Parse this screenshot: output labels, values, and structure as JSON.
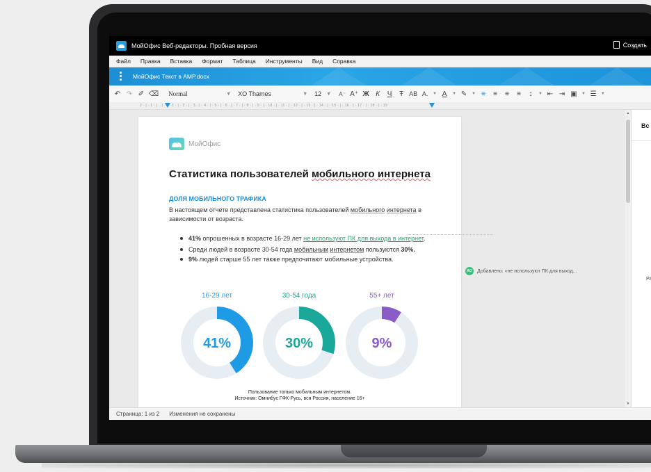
{
  "app": {
    "title": "МойОфис Веб-редакторы. Пробная версия",
    "create_label": "Создать"
  },
  "menu": [
    "Файл",
    "Правка",
    "Вставка",
    "Формат",
    "Таблица",
    "Инструменты",
    "Вид",
    "Справка"
  ],
  "document_bar": {
    "name": "МойОфис Текст в AMP.docx"
  },
  "toolbar": {
    "style_value": "Normal",
    "font_value": "XO Thames",
    "size_value": "12",
    "decrease_size": "A⁻",
    "increase_size": "A⁺",
    "bold": "Ж",
    "italic": "К",
    "underline": "Ч",
    "strike": "Ŧ",
    "caps": "AB",
    "subscript": "A.",
    "font_color": "A",
    "highlight": "✎"
  },
  "ruler": {
    "scale": "2 · | · 1 · | · 1 · | · 1 · | · 2 · | · 3 · | · 4 · | · 5 · | · 6 · | · 7 · | · 8 · | · 9 · | · 10 · | · 11 · | · 12 · | · 13 · | · 14 · | · 15 · | · 16 · | · 17 · | · 18 · | · 19"
  },
  "document": {
    "logo_text": "МойОфис",
    "heading_pre": "Статистика пользователей ",
    "heading_spell": "мобильного интернета",
    "subheading": "ДОЛЯ МОБИЛЬНОГО ТРАФИКА",
    "para_1": "В настоящем отчете представлена статистика пользователей ",
    "para_link_1": "мобильного",
    "para_space": " ",
    "para_link_2": "интернета",
    "para_2": " в зависимости от возраста.",
    "bullet_1_bold": "41%",
    "bullet_1_text": " опрошенных в возрасте 16-29 лет ",
    "bullet_1_inserted": "не используют ПК для выхода в интернет",
    "bullet_1_end": ".",
    "bullet_2_text": "Среди людей в возрасте 30-54 года ",
    "bullet_2_link_1": "мобильным",
    "bullet_2_link_2": "интернетом",
    "bullet_2_mid": " пользуются ",
    "bullet_2_bold": "30%.",
    "bullet_3_bold": "9%",
    "bullet_3_text": " людей старше 55 лет также предпочитают мобильные устройства.",
    "caption_line_1": "Пользование только мобильным интернетом.",
    "caption_line_2": "Источник: Омнибус ГФК-Русь, вся Россия, население 16+"
  },
  "chart_data": {
    "type": "pie",
    "categories": [
      "16-29 лет",
      "30-54 года",
      "55+ лет"
    ],
    "values": [
      41,
      30,
      9
    ],
    "labels": [
      "41%",
      "30%",
      "9%"
    ],
    "colors": [
      "#1f9be6",
      "#1aa89a",
      "#8a5cc8"
    ],
    "track_color": "#e7eef3"
  },
  "comment": {
    "avatar": "AO",
    "text": "Добавлено: «не используют ПК для выход..."
  },
  "side_panel": {
    "title": "Вс",
    "text": "Ра"
  },
  "status": {
    "page": "Страница: 1 из 2",
    "save_state": "Изменения не сохранены"
  }
}
